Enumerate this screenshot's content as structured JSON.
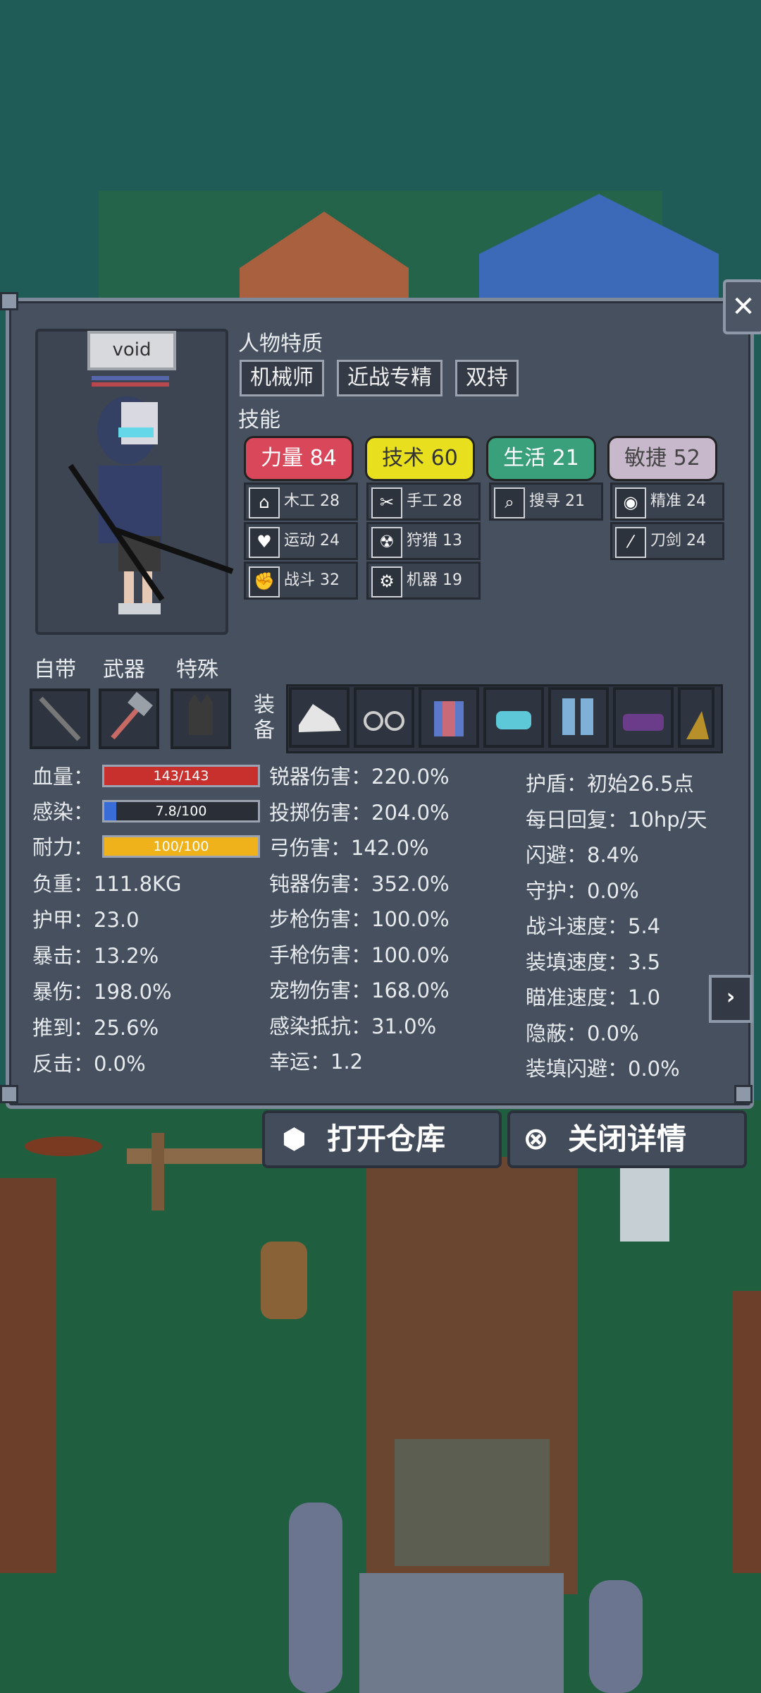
{
  "portrait": {
    "name": "void"
  },
  "traits": {
    "title": "人物特质",
    "items": [
      "机械师",
      "近战专精",
      "双持"
    ]
  },
  "skills": {
    "title": "技能",
    "attributes": [
      {
        "label": "力量 84",
        "color": "#d9485a",
        "text_color": "#fff"
      },
      {
        "label": "技术 60",
        "color": "#e8e01e",
        "text_color": "#333"
      },
      {
        "label": "生活 21",
        "color": "#3aa07c",
        "text_color": "#fff"
      },
      {
        "label": "敏捷 52",
        "color": "#c8b8cc",
        "text_color": "#444"
      }
    ],
    "col1": [
      {
        "icon": "house-icon",
        "glyph": "⌂",
        "label": "木工 28"
      },
      {
        "icon": "heart-icon",
        "glyph": "♥",
        "label": "运动 24"
      },
      {
        "icon": "fist-icon",
        "glyph": "✊",
        "label": "战斗 32"
      }
    ],
    "col2": [
      {
        "icon": "scissors-icon",
        "glyph": "✂",
        "label": "手工 28"
      },
      {
        "icon": "radiation-icon",
        "glyph": "☢",
        "label": "狩猎 13"
      },
      {
        "icon": "gear-icon",
        "glyph": "⚙",
        "label": "机器 19"
      }
    ],
    "col3": [
      {
        "icon": "magnifier-icon",
        "glyph": "⌕",
        "label": "搜寻 21"
      }
    ],
    "col4": [
      {
        "icon": "eye-icon",
        "glyph": "◉",
        "label": "精准 24"
      },
      {
        "icon": "sword-icon",
        "glyph": "⁄",
        "label": "刀剑 24"
      }
    ]
  },
  "slots": {
    "labels": [
      "自带",
      "武器",
      "特殊"
    ],
    "equip_label": "装备"
  },
  "stats_left": {
    "bars": [
      {
        "label": "血量：",
        "value": "143/143",
        "fraction": 1.0,
        "color": "#c8302e"
      },
      {
        "label": "感染：",
        "value": "7.8/100",
        "fraction": 0.078,
        "color": "#3a6cd8"
      },
      {
        "label": "耐力：",
        "value": "100/100",
        "fraction": 1.0,
        "color": "#f0b21a"
      }
    ],
    "rows": [
      "负重：111.8KG",
      "护甲：23.0",
      "暴击：13.2%",
      "暴伤：198.0%",
      "推到：25.6%",
      "反击：0.0%"
    ]
  },
  "stats_mid": [
    "锐器伤害：220.0%",
    "投掷伤害：204.0%",
    "弓伤害：142.0%",
    "钝器伤害：352.0%",
    "步枪伤害：100.0%",
    "手枪伤害：100.0%",
    "宠物伤害：168.0%",
    "感染抵抗：31.0%",
    "幸运：1.2"
  ],
  "stats_right": [
    "护盾：初始26.5点",
    "每日回复：10hp/天",
    "闪避：8.4%",
    "守护：0.0%",
    "战斗速度：5.4",
    "装填速度：3.5",
    "瞄准速度：1.0",
    "隐蔽：0.0%",
    "装填闪避：0.0%"
  ],
  "buttons": {
    "open_storage": "打开仓库",
    "close_details": "关闭详情"
  },
  "close_glyph": "✕",
  "next_glyph": "›"
}
